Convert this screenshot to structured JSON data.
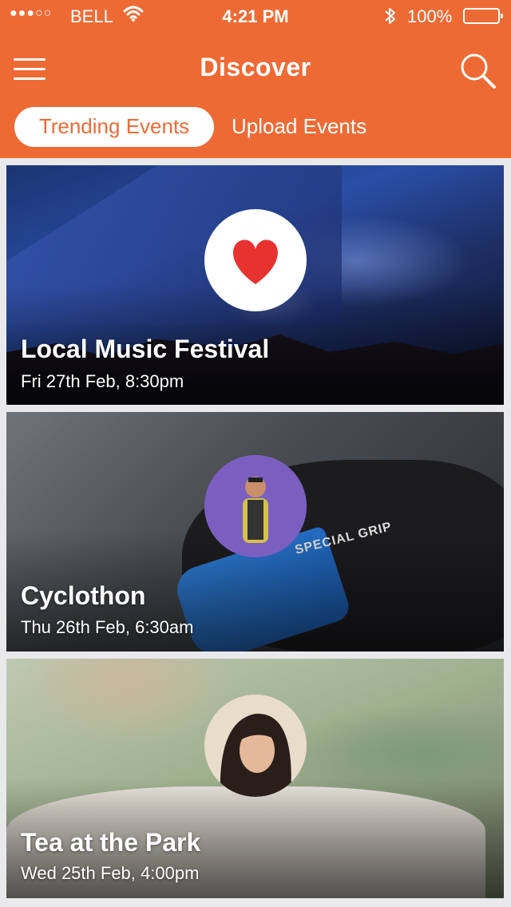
{
  "status_bar": {
    "signal": "●●●○○",
    "carrier": "BELL",
    "time": "4:21 PM",
    "battery": "100%"
  },
  "header": {
    "title": "Discover",
    "menu_icon": "hamburger-menu-icon",
    "search_icon": "search-icon"
  },
  "tabs": [
    {
      "label": "Trending Events",
      "active": true
    },
    {
      "label": "Upload Events",
      "active": false
    }
  ],
  "events": [
    {
      "title": "Local Music Festival",
      "date": "Fri 27th Feb, 8:30pm",
      "badge": "heart-icon"
    },
    {
      "title": "Cyclothon",
      "date": "Thu 26th Feb, 6:30am",
      "badge": "user-avatar",
      "image_text": "SPECIAL GRIP"
    },
    {
      "title": "Tea at the Park",
      "date": "Wed 25th Feb, 4:00pm",
      "badge": "user-avatar"
    }
  ],
  "colors": {
    "brand": "#ee6a35",
    "heart": "#e8322f"
  }
}
